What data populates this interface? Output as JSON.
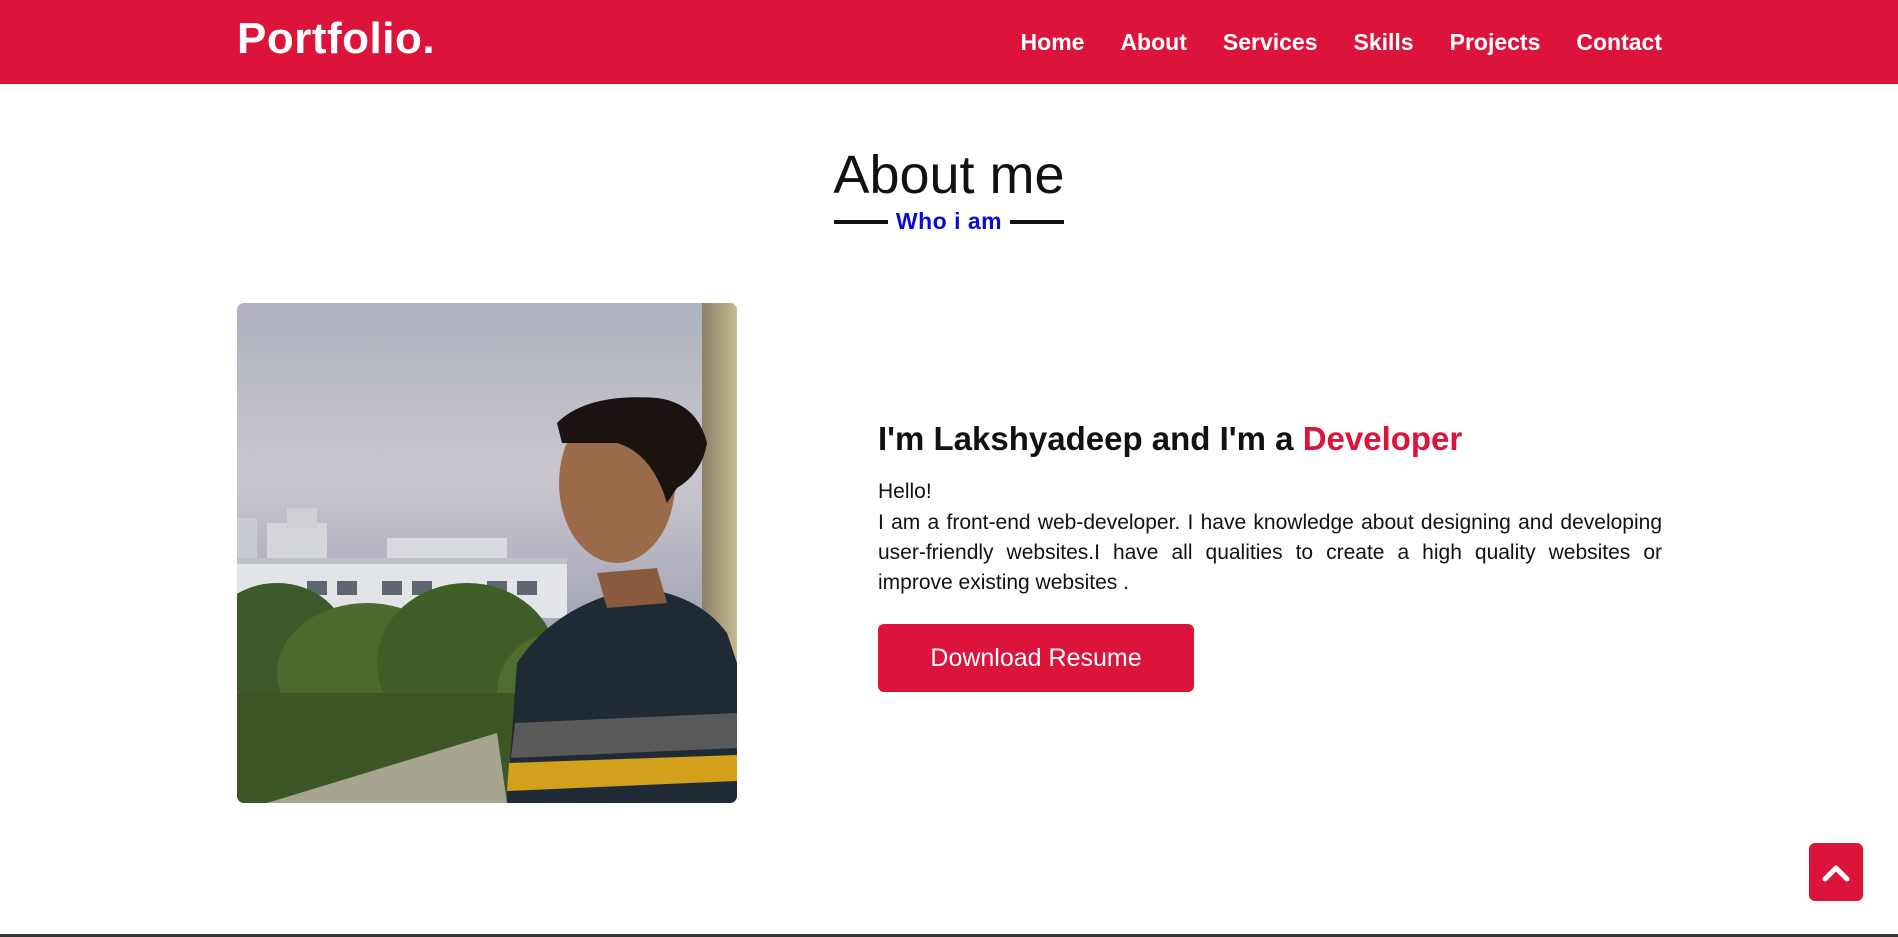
{
  "navbar": {
    "logo": "Portfolio.",
    "items": [
      "Home",
      "About",
      "Services",
      "Skills",
      "Projects",
      "Contact"
    ]
  },
  "about": {
    "title": "About me",
    "subtitle": "Who i am",
    "headline_prefix": "I'm Lakshyadeep and I'm a ",
    "headline_accent": "Developer",
    "greeting": "Hello!",
    "description": "I am a front-end web-developer. I have knowledge about designing and developing user-friendly websites.I have all qualities to create a high quality websites or improve existing websites .",
    "button_label": "Download Resume",
    "photo_icon": "profile-photo"
  },
  "scroll_top": {
    "icon": "chevron-up-icon"
  },
  "colors": {
    "accent": "#dc143c",
    "subtitle": "#0a0ad6",
    "text": "#111111",
    "background": "#ffffff"
  }
}
